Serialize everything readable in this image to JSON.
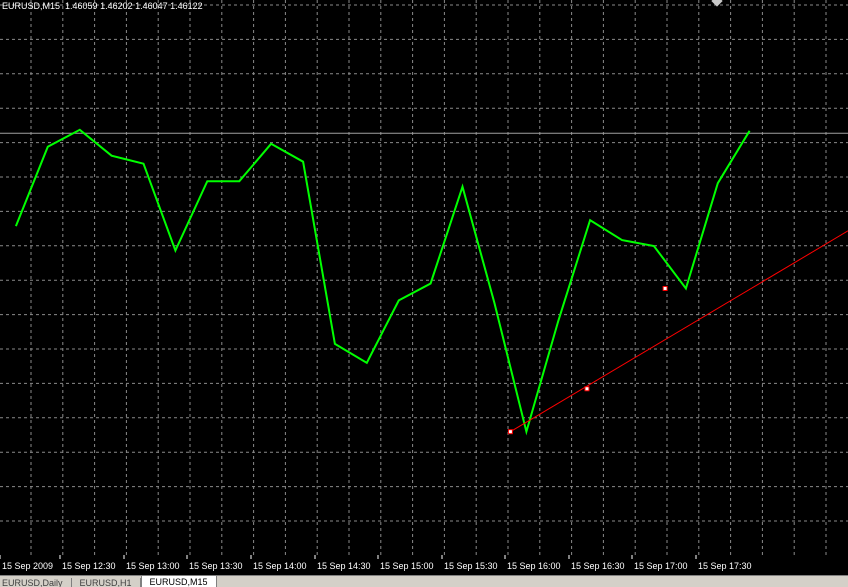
{
  "header": {
    "symbol_timeframe": "EURUSD,M15",
    "ohlc": "1.46059 1.46202 1.46047 1.46122"
  },
  "tabs": [
    {
      "label": "EURUSD,Daily",
      "active": false
    },
    {
      "label": "EURUSD,H1",
      "active": false
    },
    {
      "label": "EURUSD,M15",
      "active": true
    }
  ],
  "colors": {
    "background": "#000000",
    "grid": "#8a8a8a",
    "price_line": "#00ff00",
    "trendline": "#ff0000",
    "axis_text": "#ffffff",
    "level_line": "#a0a0a0"
  },
  "chart_data": {
    "type": "line",
    "title": "",
    "xlabel": "",
    "ylabel": "",
    "grid": true,
    "x_tick_labels": [
      "15 Sep 2009",
      "15 Sep 12:30",
      "15 Sep 13:00",
      "15 Sep 13:30",
      "15 Sep 14:00",
      "15 Sep 14:30",
      "15 Sep 15:00",
      "15 Sep 15:30",
      "15 Sep 16:00",
      "15 Sep 16:30",
      "15 Sep 17:00",
      "15 Sep 17:30"
    ],
    "x_index_range": [
      -0.5,
      26.15
    ],
    "y_range": [
      0.0,
      1.0
    ],
    "series": [
      {
        "values": [
          0.589,
          0.748,
          0.782,
          0.73,
          0.714,
          0.54,
          0.679,
          0.679,
          0.754,
          0.718,
          0.353,
          0.315,
          0.44,
          0.474,
          0.668,
          0.435,
          0.177,
          0.399,
          0.601,
          0.561,
          0.549,
          0.464,
          0.675,
          0.78
        ]
      }
    ],
    "level_line_value": 0.775,
    "trendline": {
      "from": {
        "x": 15.5,
        "y": 0.177
      },
      "to": {
        "x": 26.15,
        "y": 0.582
      },
      "anchors": [
        {
          "x": 15.5,
          "y": 0.177
        },
        {
          "x": 17.9,
          "y": 0.263
        },
        {
          "x": 20.35,
          "y": 0.464
        }
      ]
    }
  }
}
